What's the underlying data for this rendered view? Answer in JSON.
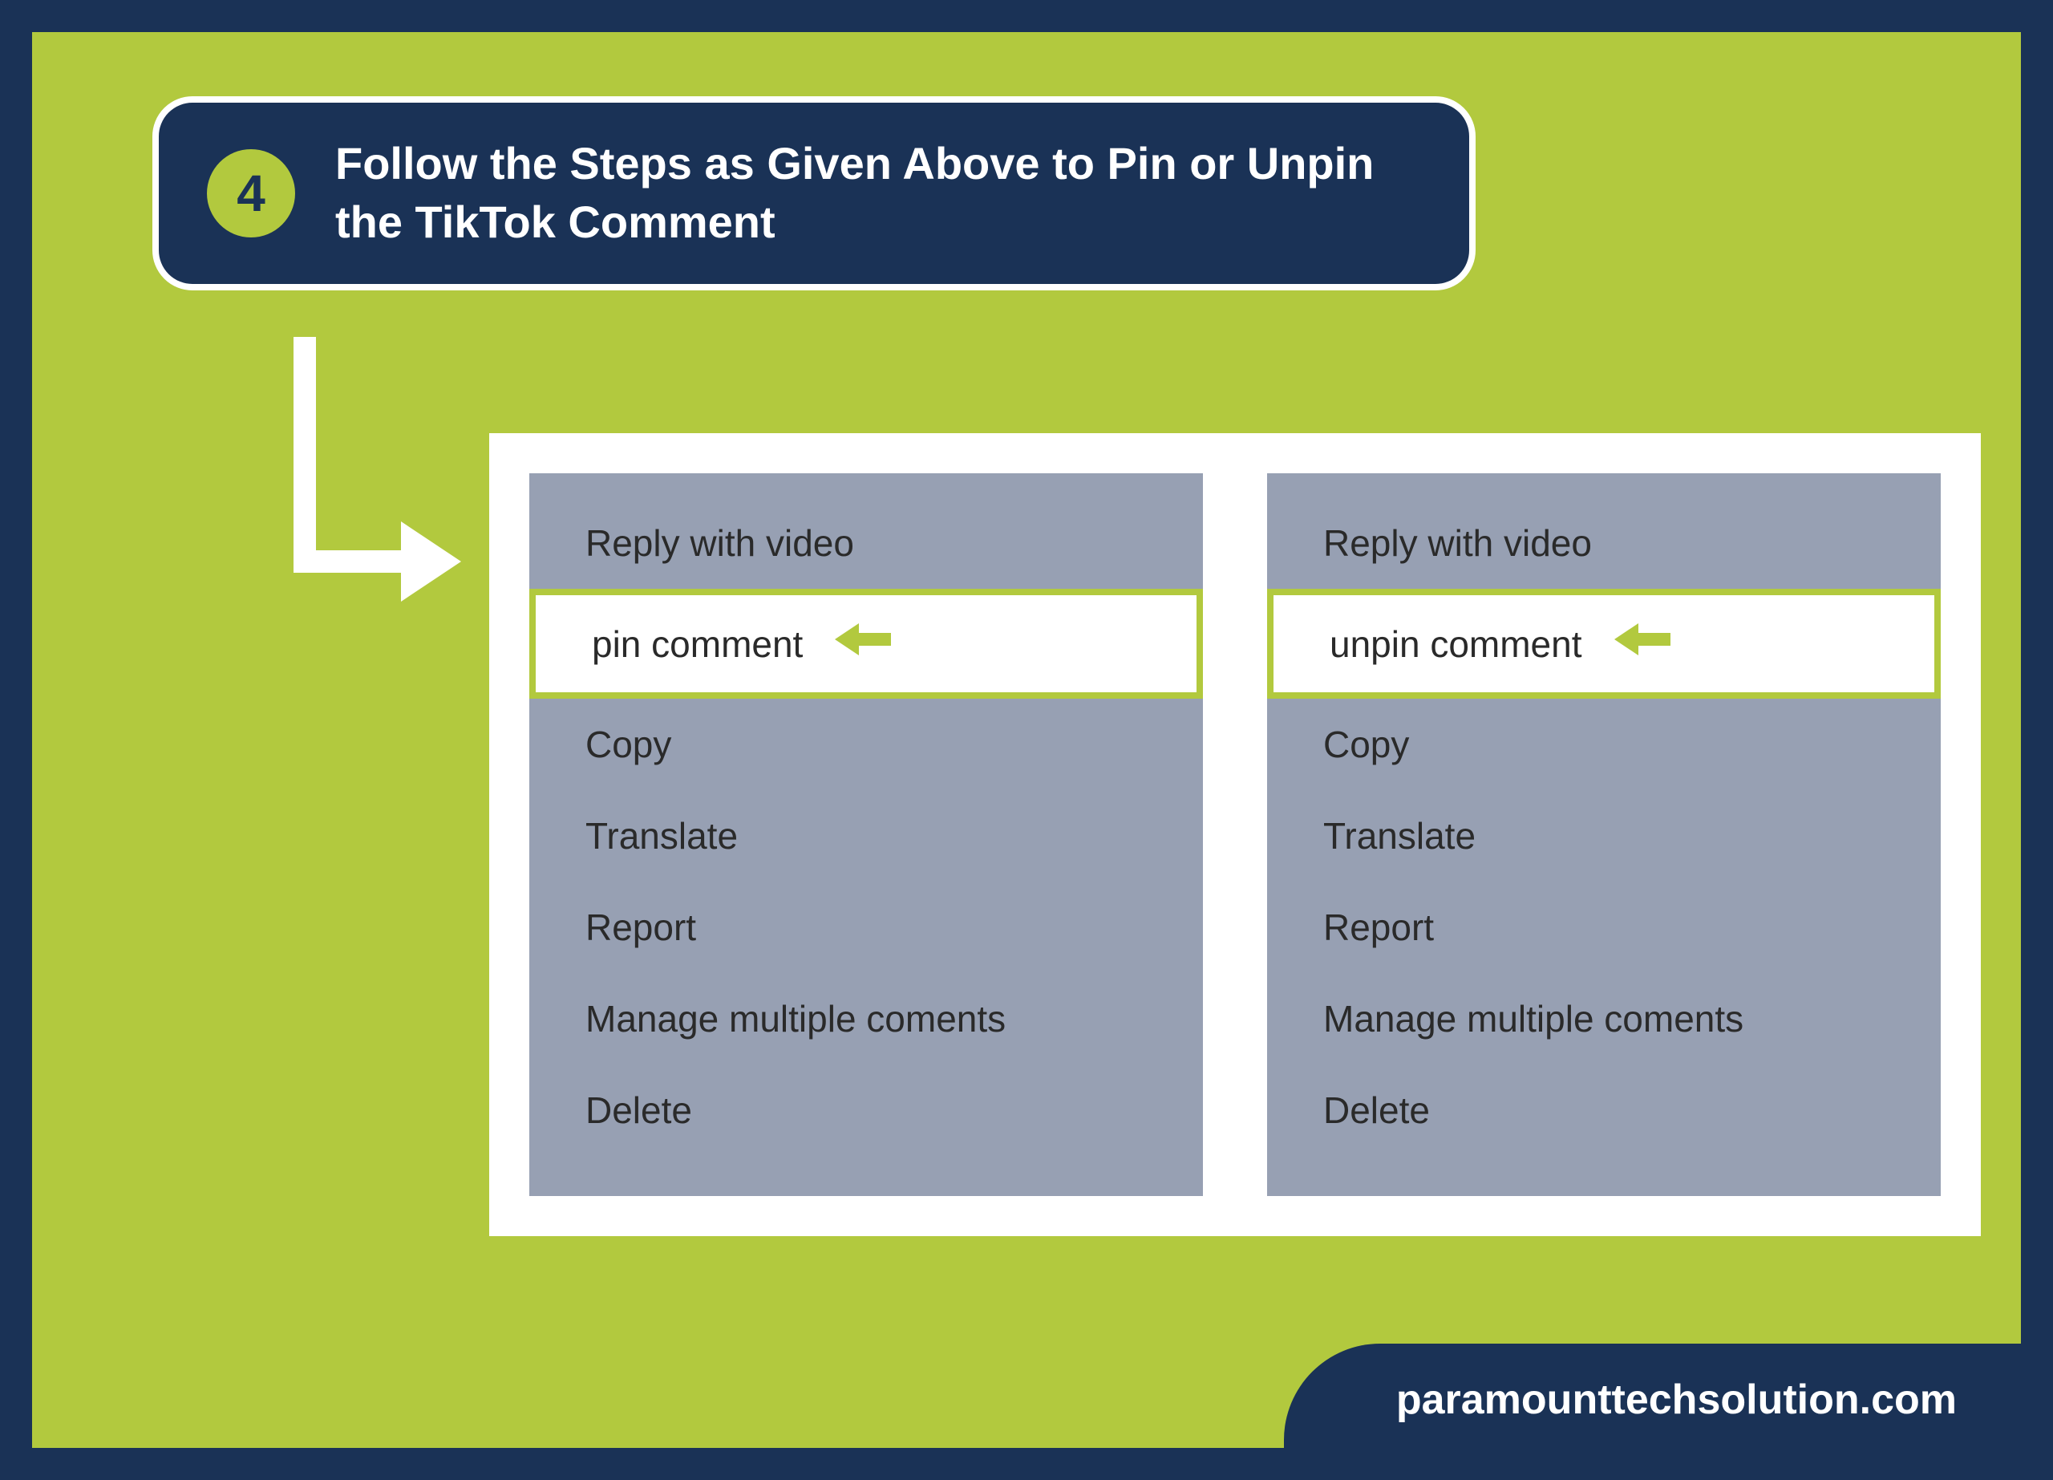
{
  "step": {
    "number": "4",
    "title": "Follow the Steps as Given Above to Pin or Unpin the TikTok Comment"
  },
  "panels": [
    {
      "id": "pin",
      "items": [
        {
          "label": "Reply with video",
          "highlighted": false
        },
        {
          "label": "pin comment",
          "highlighted": true
        },
        {
          "label": "Copy",
          "highlighted": false
        },
        {
          "label": "Translate",
          "highlighted": false
        },
        {
          "label": "Report",
          "highlighted": false
        },
        {
          "label": "Manage multiple coments",
          "highlighted": false
        },
        {
          "label": "Delete",
          "highlighted": false
        }
      ]
    },
    {
      "id": "unpin",
      "items": [
        {
          "label": "Reply with video",
          "highlighted": false
        },
        {
          "label": "unpin comment",
          "highlighted": true
        },
        {
          "label": "Copy",
          "highlighted": false
        },
        {
          "label": "Translate",
          "highlighted": false
        },
        {
          "label": "Report",
          "highlighted": false
        },
        {
          "label": "Manage multiple coments",
          "highlighted": false
        },
        {
          "label": "Delete",
          "highlighted": false
        }
      ]
    }
  ],
  "footer": {
    "label": "paramounttechsolution.com"
  },
  "colors": {
    "accent": "#b2c93e",
    "navy": "#1a3256",
    "panel": "#97a0b3"
  }
}
